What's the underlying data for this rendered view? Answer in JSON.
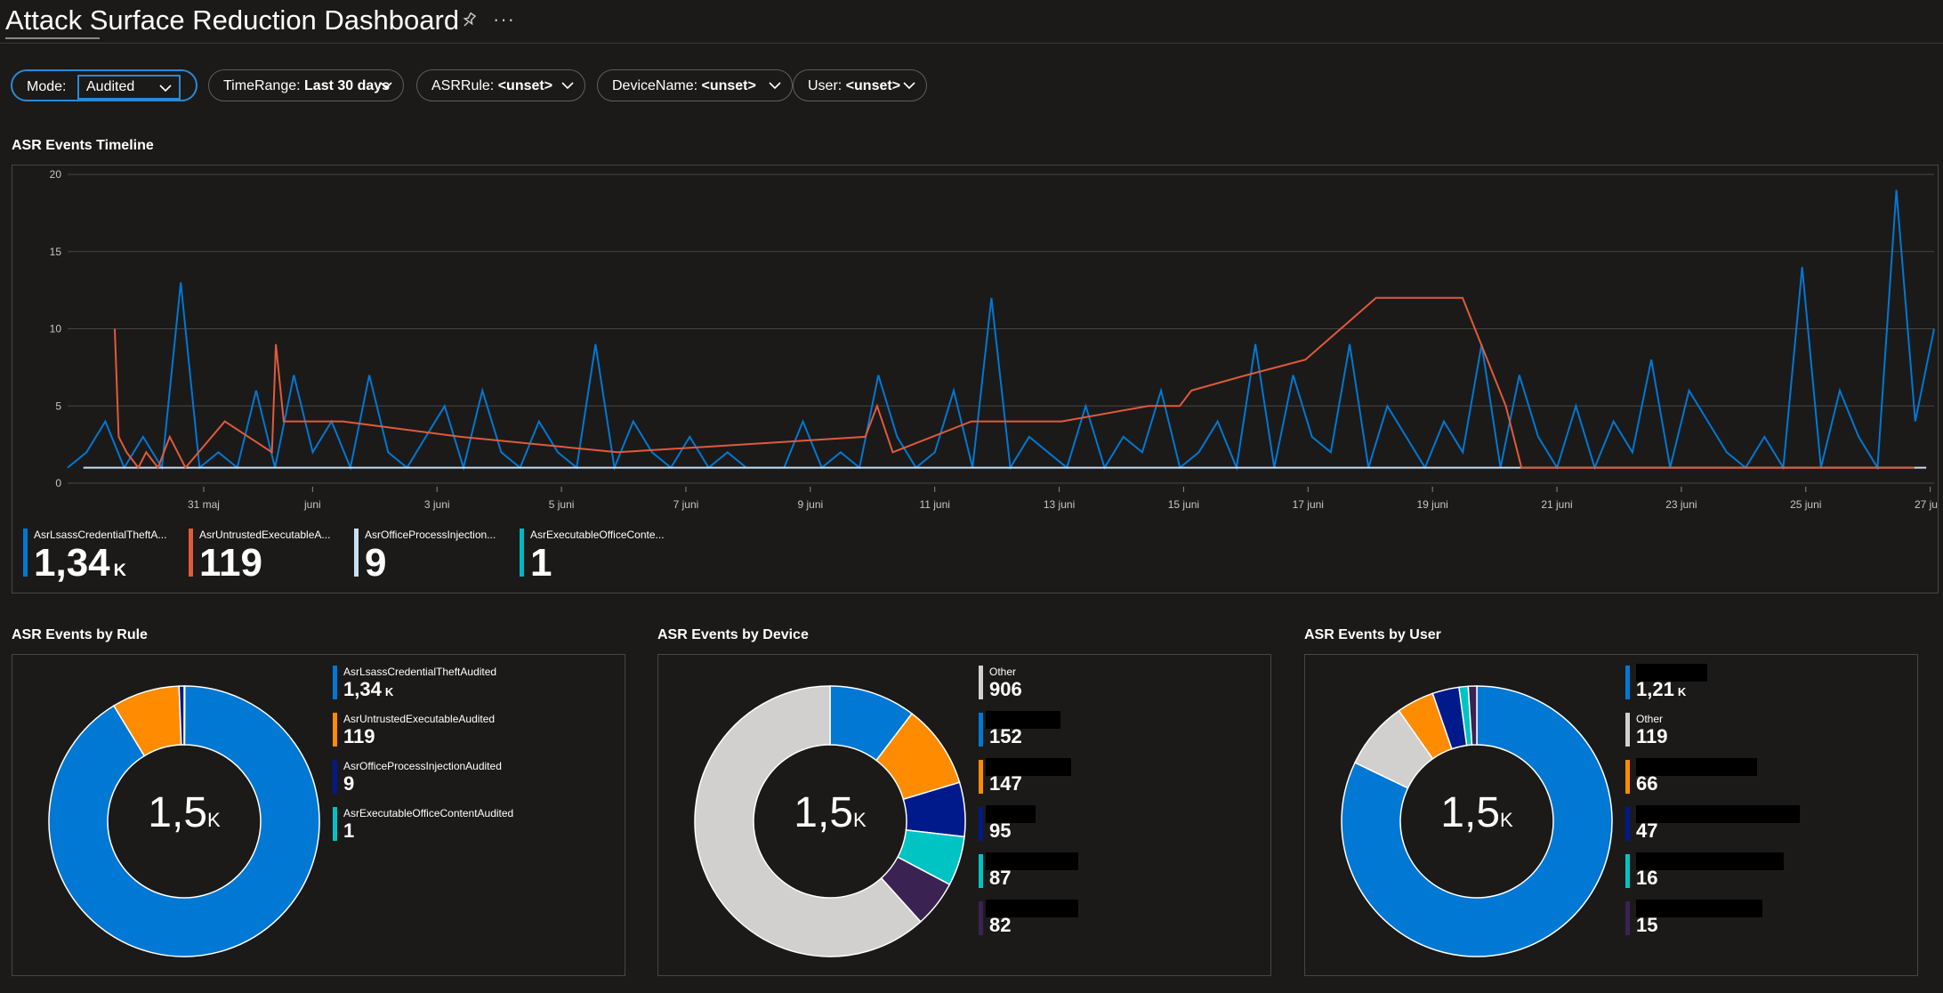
{
  "header": {
    "title": "Attack Surface Reduction Dashboard",
    "more": "···"
  },
  "filters": {
    "mode_label": "Mode:",
    "mode_value": "Audited",
    "time_label": "TimeRange:",
    "time_value": "Last 30 days",
    "rule_label": "ASRRule:",
    "rule_value": "<unset>",
    "device_label": "DeviceName:",
    "device_value": "<unset>",
    "user_label": "User:",
    "user_value": "<unset>"
  },
  "timeline": {
    "title": "ASR Events Timeline",
    "legend": [
      {
        "name": "AsrLsassCredentialTheftA...",
        "value": "1,34",
        "unit": "K",
        "color": "#0078d4"
      },
      {
        "name": "AsrUntrustedExecutableA...",
        "value": "119",
        "unit": "",
        "color": "#e05a3c"
      },
      {
        "name": "AsrOfficeProcessInjection...",
        "value": "9",
        "unit": "",
        "color": "#c7e0f4"
      },
      {
        "name": "AsrExecutableOfficeConte...",
        "value": "1",
        "unit": "",
        "color": "#00b7c3"
      }
    ]
  },
  "by_rule": {
    "title": "ASR Events by Rule",
    "center_value": "1,5",
    "center_unit": "K",
    "legend": [
      {
        "name": "AsrLsassCredentialTheftAudited",
        "value": "1,34",
        "unit": "K",
        "color": "#0078d4"
      },
      {
        "name": "AsrUntrustedExecutableAudited",
        "value": "119",
        "unit": "",
        "color": "#ff8c00"
      },
      {
        "name": "AsrOfficeProcessInjectionAudited",
        "value": "9",
        "unit": "",
        "color": "#001a8c"
      },
      {
        "name": "AsrExecutableOfficeContentAudited",
        "value": "1",
        "unit": "",
        "color": "#00c4c4"
      }
    ]
  },
  "by_device": {
    "title": "ASR Events by Device",
    "center_value": "1,5",
    "center_unit": "K",
    "legend": [
      {
        "name": "Other",
        "value": "906",
        "color": "#d2d0ce"
      },
      {
        "name": "",
        "value": "152",
        "color": "#0078d4"
      },
      {
        "name": "",
        "value": "147",
        "color": "#ff8c00"
      },
      {
        "name": "",
        "value": "95",
        "color": "#001a8c"
      },
      {
        "name": "",
        "value": "87",
        "color": "#00c4c4"
      },
      {
        "name": "",
        "value": "82",
        "color": "#3a2352"
      }
    ]
  },
  "by_user": {
    "title": "ASR Events by User",
    "center_value": "1,5",
    "center_unit": "K",
    "legend": [
      {
        "name": "",
        "value": "1,21",
        "unit": "K",
        "color": "#0078d4"
      },
      {
        "name": "Other",
        "value": "119",
        "unit": "",
        "color": "#d2d0ce"
      },
      {
        "name": "",
        "value": "66",
        "unit": "",
        "color": "#ff8c00"
      },
      {
        "name": "",
        "value": "47",
        "unit": "",
        "color": "#001a8c"
      },
      {
        "name": "",
        "value": "16",
        "unit": "",
        "color": "#00c4c4"
      },
      {
        "name": "",
        "value": "15",
        "unit": "",
        "color": "#3a2352"
      }
    ]
  },
  "chart_data": [
    {
      "type": "line",
      "title": "ASR Events Timeline",
      "ylim": [
        0,
        20
      ],
      "yticks": [
        "0",
        "5",
        "10",
        "15",
        "20"
      ],
      "xticks": [
        "31 maj",
        "juni",
        "3 juni",
        "5 juni",
        "7 juni",
        "9 juni",
        "11 juni",
        "13 juni",
        "15 juni",
        "17 juni",
        "19 juni",
        "21 juni",
        "23 juni",
        "25 juni",
        "27 juni"
      ],
      "grid": true,
      "series": [
        {
          "name": "AsrLsassCredentialTheftA...",
          "color": "#0078d4",
          "x": [
            0,
            0.3,
            0.6,
            0.9,
            1.2,
            1.5,
            1.8,
            2.1,
            2.4,
            2.7,
            3.0,
            3.3,
            3.6,
            3.9,
            4.2,
            4.5,
            4.8,
            5.1,
            5.4,
            5.7,
            6.0,
            6.3,
            6.6,
            6.9,
            7.2,
            7.5,
            7.8,
            8.1,
            8.4,
            8.7,
            9.0,
            9.3,
            9.6,
            9.9,
            10.2,
            10.5,
            10.8,
            11.1,
            11.4,
            11.7,
            12.0,
            12.3,
            12.6,
            12.9,
            13.2,
            13.5,
            13.8,
            14.1,
            14.4,
            14.7,
            15.0,
            15.3,
            15.6,
            15.9,
            16.2,
            16.5,
            16.8,
            17.1,
            17.4,
            17.7,
            18.0,
            18.3,
            18.6,
            18.9,
            19.2,
            19.5,
            19.8,
            20.1,
            20.4,
            20.7,
            21.0,
            21.3,
            21.6,
            21.9,
            22.2,
            22.5,
            22.8,
            23.1,
            23.4,
            23.7,
            24.0,
            24.3,
            24.6,
            24.9,
            25.2,
            25.5,
            25.8,
            26.1,
            26.4,
            26.7,
            27.0,
            27.3,
            27.6,
            27.9,
            28.2,
            28.5,
            28.8,
            29.1,
            29.4,
            29.7
          ],
          "y": [
            1,
            2,
            4,
            1,
            3,
            1,
            13,
            1,
            2,
            1,
            6,
            1,
            7,
            2,
            4,
            1,
            7,
            2,
            1,
            3,
            5,
            1,
            6,
            2,
            1,
            4,
            2,
            1,
            9,
            1,
            4,
            2,
            1,
            3,
            1,
            2,
            1,
            1,
            1,
            4,
            1,
            2,
            1,
            7,
            3,
            1,
            2,
            6,
            1,
            12,
            1,
            3,
            2,
            1,
            5,
            1,
            3,
            2,
            6,
            1,
            2,
            4,
            1,
            9,
            1,
            7,
            3,
            2,
            9,
            1,
            5,
            3,
            1,
            4,
            2,
            9,
            1,
            7,
            3,
            1,
            5,
            1,
            4,
            2,
            8,
            1,
            6,
            4,
            2,
            1,
            3,
            1,
            14,
            1,
            6,
            3,
            1,
            19,
            4,
            10
          ]
        },
        {
          "name": "AsrUntrustedExecutableA...",
          "color": "#e05a3c",
          "x": [
            1.2,
            1.3,
            1.5,
            1.8,
            2.0,
            2.3,
            2.6,
            3.0,
            4.0,
            5.2,
            5.3,
            5.5,
            7.0,
            10.0,
            14.0,
            20.3,
            20.6,
            21.0,
            23.0,
            25.3,
            27.5,
            28.3,
            28.6,
            30.0,
            31.5,
            33.3,
            35.5,
            36.6,
            37.0,
            38.1,
            38.5,
            40.0,
            43.0,
            46.5,
            47.0
          ],
          "y": [
            10,
            3,
            2,
            1,
            2,
            1,
            3,
            1,
            4,
            2,
            9,
            4,
            4,
            3,
            2,
            3,
            5,
            2,
            4,
            4,
            5,
            5,
            6,
            7,
            8,
            12,
            12,
            5,
            1,
            1,
            1,
            1,
            1,
            1,
            1
          ]
        }
      ]
    },
    {
      "type": "pie",
      "title": "ASR Events by Rule",
      "categories": [
        "AsrLsassCredentialTheftAudited",
        "AsrUntrustedExecutableAudited",
        "AsrOfficeProcessInjectionAudited",
        "AsrExecutableOfficeContentAudited"
      ],
      "values": [
        1340,
        119,
        9,
        1
      ],
      "colors": [
        "#0078d4",
        "#ff8c00",
        "#001a8c",
        "#00c4c4"
      ],
      "center_label": "1,5K"
    },
    {
      "type": "pie",
      "title": "ASR Events by Device",
      "categories": [
        "Other",
        "",
        "",
        "",
        "",
        ""
      ],
      "values": [
        906,
        152,
        147,
        95,
        87,
        82
      ],
      "colors": [
        "#d2d0ce",
        "#0078d4",
        "#ff8c00",
        "#001a8c",
        "#00c4c4",
        "#3a2352"
      ],
      "center_label": "1,5K"
    },
    {
      "type": "pie",
      "title": "ASR Events by User",
      "categories": [
        "",
        "Other",
        "",
        "",
        "",
        ""
      ],
      "values": [
        1210,
        119,
        66,
        47,
        16,
        15
      ],
      "colors": [
        "#0078d4",
        "#d2d0ce",
        "#ff8c00",
        "#001a8c",
        "#00c4c4",
        "#3a2352"
      ],
      "center_label": "1,5K"
    }
  ]
}
